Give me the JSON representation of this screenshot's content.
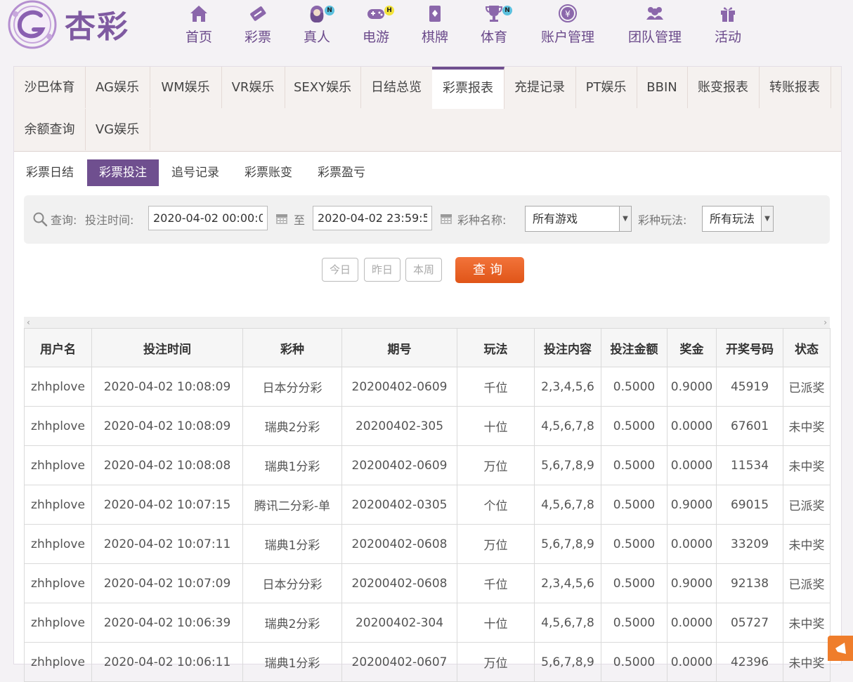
{
  "brand": {
    "name": "杏彩"
  },
  "nav": [
    {
      "label": "首页",
      "icon": "home-icon"
    },
    {
      "label": "彩票",
      "icon": "lottery-ticket-icon"
    },
    {
      "label": "真人",
      "icon": "live-dealer-icon",
      "badge": "N"
    },
    {
      "label": "电游",
      "icon": "gamepad-icon",
      "badge": "H"
    },
    {
      "label": "棋牌",
      "icon": "cards-icon"
    },
    {
      "label": "体育",
      "icon": "trophy-icon",
      "badge": "N"
    },
    {
      "label": "账户管理",
      "icon": "yuan-coin-icon"
    },
    {
      "label": "团队管理",
      "icon": "team-icon"
    },
    {
      "label": "活动",
      "icon": "gift-icon"
    }
  ],
  "report_tabs": [
    "沙巴体育",
    "AG娱乐",
    "WM娱乐",
    "VR娱乐",
    "SEXY娱乐",
    "日结总览",
    "彩票报表",
    "充提记录",
    "PT娱乐",
    "BBIN",
    "账变报表",
    "转账报表",
    "余额查询",
    "VG娱乐"
  ],
  "active_report_tab": "彩票报表",
  "sub_tabs": [
    "彩票日结",
    "彩票投注",
    "追号记录",
    "彩票账变",
    "彩票盈亏"
  ],
  "active_sub_tab": "彩票投注",
  "query": {
    "title": "查询:",
    "time_label": "投注时间:",
    "start": "2020-04-02 00:00:00",
    "to": "至",
    "end": "2020-04-02 23:59:59",
    "game_label": "彩种名称:",
    "game_value": "所有游戏",
    "play_label": "彩种玩法:",
    "play_value": "所有玩法"
  },
  "quick_buttons": [
    "今日",
    "昨日",
    "本周"
  ],
  "search_button": "查询",
  "table": {
    "headers": [
      "用户名",
      "投注时间",
      "彩种",
      "期号",
      "玩法",
      "投注内容",
      "投注金额",
      "奖金",
      "开奖号码",
      "状态"
    ],
    "rows": [
      [
        "zhhplove",
        "2020-04-02 10:08:09",
        "日本分分彩",
        "20200402-0609",
        "千位",
        "2,3,4,5,6",
        "0.5000",
        "0.9000",
        "45919",
        "已派奖"
      ],
      [
        "zhhplove",
        "2020-04-02 10:08:09",
        "瑞典2分彩",
        "20200402-305",
        "十位",
        "4,5,6,7,8",
        "0.5000",
        "0.0000",
        "67601",
        "未中奖"
      ],
      [
        "zhhplove",
        "2020-04-02 10:08:08",
        "瑞典1分彩",
        "20200402-0609",
        "万位",
        "5,6,7,8,9",
        "0.5000",
        "0.0000",
        "11534",
        "未中奖"
      ],
      [
        "zhhplove",
        "2020-04-02 10:07:15",
        "腾讯二分彩-单",
        "20200402-0305",
        "个位",
        "4,5,6,7,8",
        "0.5000",
        "0.9000",
        "69015",
        "已派奖"
      ],
      [
        "zhhplove",
        "2020-04-02 10:07:11",
        "瑞典1分彩",
        "20200402-0608",
        "万位",
        "5,6,7,8,9",
        "0.5000",
        "0.0000",
        "33209",
        "未中奖"
      ],
      [
        "zhhplove",
        "2020-04-02 10:07:09",
        "日本分分彩",
        "20200402-0608",
        "千位",
        "2,3,4,5,6",
        "0.5000",
        "0.9000",
        "92138",
        "已派奖"
      ],
      [
        "zhhplove",
        "2020-04-02 10:06:39",
        "瑞典2分彩",
        "20200402-304",
        "十位",
        "4,5,6,7,8",
        "0.5000",
        "0.0000",
        "05727",
        "未中奖"
      ],
      [
        "zhhplove",
        "2020-04-02 10:06:11",
        "瑞典1分彩",
        "20200402-0607",
        "万位",
        "5,6,7,8,9",
        "0.5000",
        "0.0000",
        "42396",
        "未中奖"
      ]
    ]
  },
  "colors": {
    "brand_purple": "#6f4f8f",
    "accent_orange": "#e8601f",
    "paid_status": "#e06a1c",
    "lost_status": "#999999"
  }
}
